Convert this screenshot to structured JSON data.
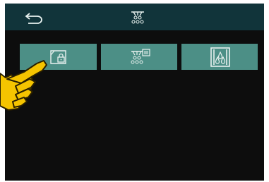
{
  "header": {
    "back_icon": "back-arrow-icon",
    "title_icon": "shower-icon"
  },
  "tiles": [
    {
      "icon": "locked-card-icon"
    },
    {
      "icon": "shower-control-icon"
    },
    {
      "icon": "water-drops-icon"
    }
  ],
  "colors": {
    "header": "#11343a",
    "tile": "#4c8f86",
    "screen": "#0d0d0d",
    "icon": "#e8f1ef",
    "hand": "#f5c400"
  }
}
